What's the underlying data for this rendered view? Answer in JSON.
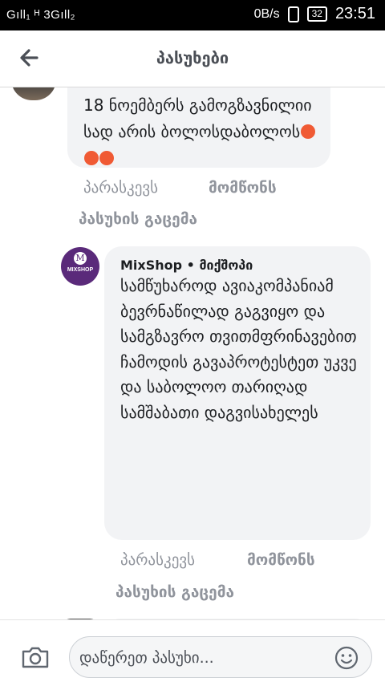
{
  "status_bar": {
    "signal": "Gıll₁ ᴴ 3Gıll₂",
    "speed": "0B/s",
    "battery": "32",
    "time": "23:51"
  },
  "header": {
    "title": "პასუხები"
  },
  "comments": [
    {
      "text": "18 ნოემბერს გამოგზავნილიი სად არის ბოლოსდაბოლოს",
      "time": "პარასკევს",
      "like": "მომწონს",
      "reply": "პასუხის გაცემა"
    },
    {
      "author": "MixShop • მიქშოპი",
      "avatar_text": "MIXSHOP",
      "avatar_letter": "M",
      "text": "სამწუხაროდ ავიაკომპანიამ ბევრნაწილად გაგვიყო და სამგზავრო თვითმფრინავებით ჩამოდის გავაპროტესტეთ უკვე და საბოლოო თარიღად სამშაბათი დაგვისახელეს",
      "time": "პარასკევს",
      "like": "მომწონს",
      "reply": "პასუხის გაცემა"
    }
  ],
  "composer": {
    "placeholder": "დაწერეთ პასუხი..."
  },
  "colors": {
    "bubble": "#f2f3f5",
    "meta": "#90949c",
    "avatar": "#5a2a7a",
    "angry_emoji": "#f05a34"
  },
  "icons": [
    "back-arrow-icon",
    "camera-icon",
    "smiley-icon",
    "angry-emoji-icon",
    "vibrate-icon",
    "battery-icon"
  ]
}
